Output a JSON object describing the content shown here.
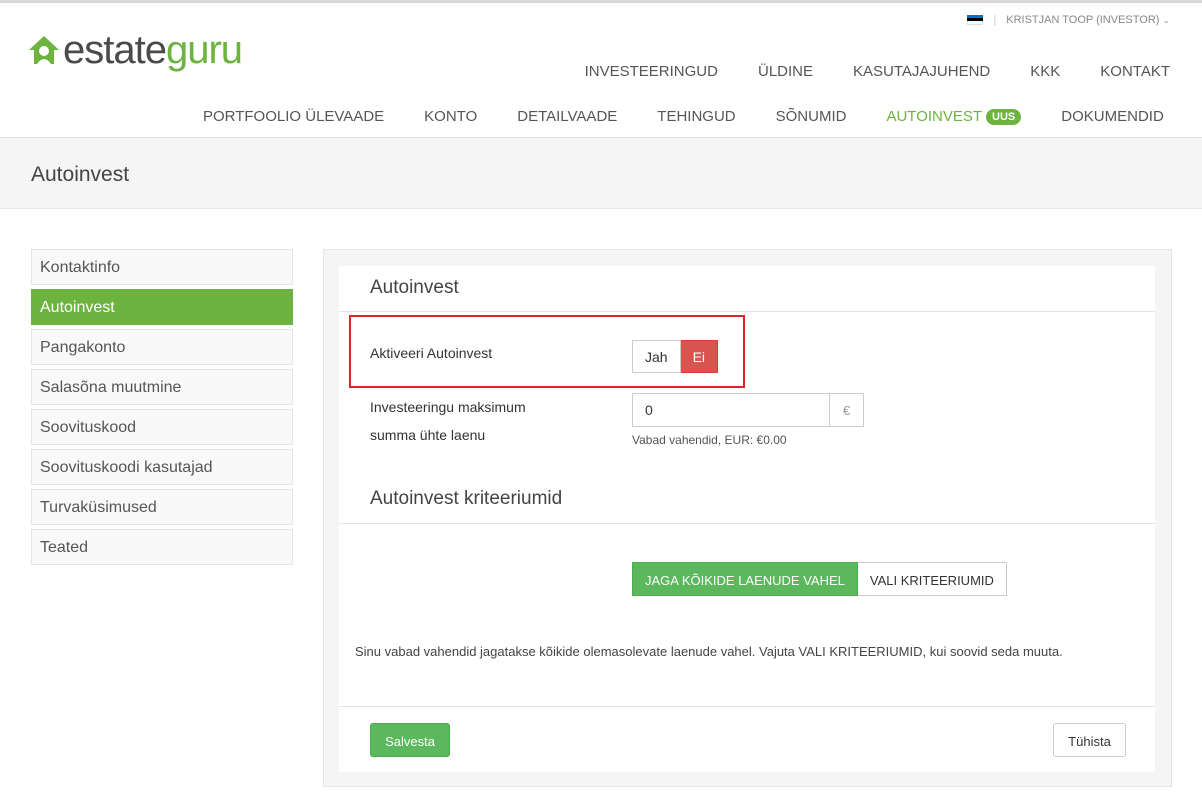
{
  "brand": {
    "part1": "estate",
    "part2": "guru",
    "accent": "#6cb33f"
  },
  "user": {
    "flag": "flag-estonia-icon",
    "name": "KRISTJAN TOOP (INVESTOR)"
  },
  "main_nav": [
    "INVESTEERINGUD",
    "ÜLDINE",
    "KASUTAJAJUHEND",
    "KKK",
    "KONTAKT"
  ],
  "sub_nav": {
    "items": [
      "PORTFOOLIO ÜLEVAADE",
      "KONTO",
      "DETAILVAADE",
      "TEHINGUD",
      "SÕNUMID",
      "AUTOINVEST",
      "DOKUMENDID"
    ],
    "active": "AUTOINVEST",
    "badge": "UUS"
  },
  "page_title": "Autoinvest",
  "sidebar": {
    "items": [
      "Kontaktinfo",
      "Autoinvest",
      "Pangakonto",
      "Salasõna muutmine",
      "Soovituskood",
      "Soovituskoodi kasutajad",
      "Turvaküsimused",
      "Teated"
    ],
    "active": "Autoinvest"
  },
  "autoinvest": {
    "section_title": "Autoinvest",
    "activate_label": "Aktiveeri Autoinvest",
    "toggle": {
      "yes": "Jah",
      "no": "Ei",
      "selected": "Ei"
    },
    "max_amount_label_line1": "Investeeringu maksimum",
    "max_amount_label_line2": "summa ühte laenu",
    "max_amount_value": "0",
    "currency_symbol": "€",
    "available_funds": "Vabad vahendid, EUR: €0.00"
  },
  "criteria": {
    "section_title": "Autoinvest kriteeriumid",
    "option_all": "JAGA KÕIKIDE LAENUDE VAHEL",
    "option_select": "VALI KRITEERIUMID",
    "selected": "JAGA KÕIKIDE LAENUDE VAHEL",
    "info_text": "Sinu vabad vahendid jagatakse kõikide olemasolevate laenude vahel. Vajuta VALI KRITEERIUMID, kui soovid seda muuta."
  },
  "actions": {
    "save": "Salvesta",
    "cancel": "Tühista"
  }
}
